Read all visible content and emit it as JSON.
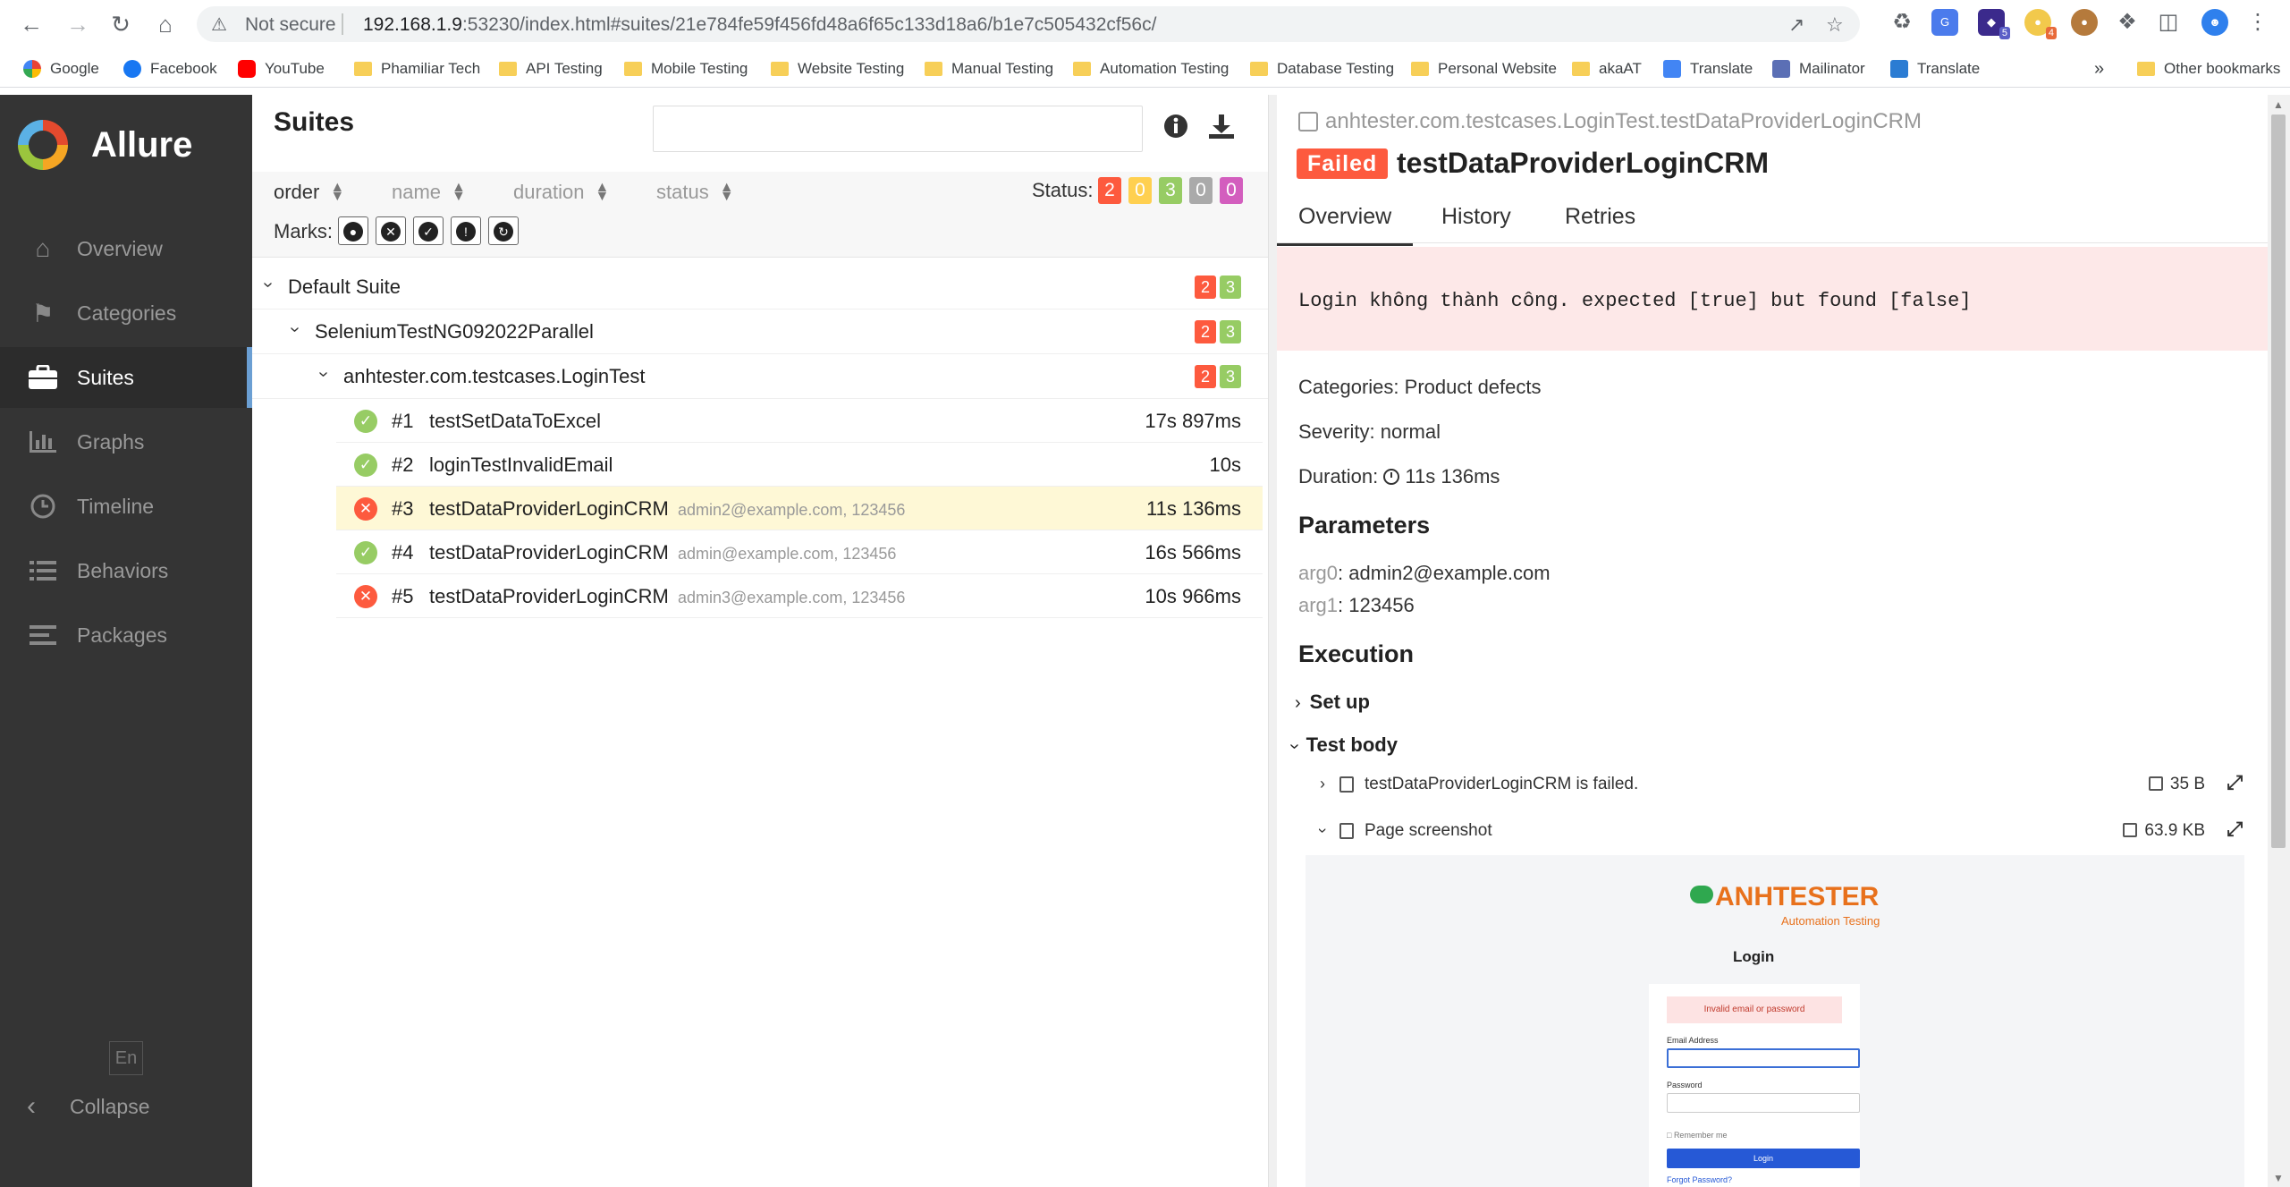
{
  "browser": {
    "not_secure": "Not secure",
    "url_host": "192.168.1.9",
    "url_rest": ":53230/index.html#suites/21e784fe59f456fd48a6f65c133d18a6/b1e7c505432cf56c/",
    "extension_badges": [
      "5",
      "4"
    ],
    "bookmarks": [
      "Google",
      "Facebook",
      "YouTube",
      "Phamiliar Tech",
      "API Testing",
      "Mobile Testing",
      "Website Testing",
      "Manual Testing",
      "Automation Testing",
      "Database Testing",
      "Personal Website",
      "akaAT",
      "Translate",
      "Mailinator",
      "Translate"
    ],
    "more_bookmarks": "»",
    "other_bookmarks": "Other bookmarks"
  },
  "sidebar": {
    "brand": "Allure",
    "items": [
      {
        "label": "Overview",
        "icon": "home-icon"
      },
      {
        "label": "Categories",
        "icon": "flag-icon"
      },
      {
        "label": "Suites",
        "icon": "briefcase-icon"
      },
      {
        "label": "Graphs",
        "icon": "bar-chart-icon"
      },
      {
        "label": "Timeline",
        "icon": "clock-icon"
      },
      {
        "label": "Behaviors",
        "icon": "list-icon"
      },
      {
        "label": "Packages",
        "icon": "align-left-icon"
      }
    ],
    "active": "Suites",
    "language": "En",
    "collapse": "Collapse"
  },
  "suites": {
    "title": "Suites",
    "search_placeholder": "",
    "sort": [
      "order",
      "name",
      "duration",
      "status"
    ],
    "status_label": "Status:",
    "status_counts": [
      {
        "value": "2",
        "color": "#fd5a3e"
      },
      {
        "value": "0",
        "color": "#ffd050"
      },
      {
        "value": "3",
        "color": "#97cc64"
      },
      {
        "value": "0",
        "color": "#aaaaaa"
      },
      {
        "value": "0",
        "color": "#d35ebe"
      }
    ],
    "marks_label": "Marks:",
    "tree": [
      {
        "label": "Default Suite",
        "failed": "2",
        "passed": "3"
      },
      {
        "label": "SeleniumTestNG092022Parallel",
        "failed": "2",
        "passed": "3"
      },
      {
        "label": "anhtester.com.testcases.LoginTest",
        "failed": "2",
        "passed": "3"
      }
    ],
    "tests": [
      {
        "num": "#1",
        "name": "testSetDataToExcel",
        "params": "",
        "duration": "17s 897ms",
        "status": "passed"
      },
      {
        "num": "#2",
        "name": "loginTestInvalidEmail",
        "params": "",
        "duration": "10s",
        "status": "passed"
      },
      {
        "num": "#3",
        "name": "testDataProviderLoginCRM",
        "params": "admin2@example.com, 123456",
        "duration": "11s 136ms",
        "status": "failed"
      },
      {
        "num": "#4",
        "name": "testDataProviderLoginCRM",
        "params": "admin@example.com, 123456",
        "duration": "16s 566ms",
        "status": "passed"
      },
      {
        "num": "#5",
        "name": "testDataProviderLoginCRM",
        "params": "admin3@example.com, 123456",
        "duration": "10s 966ms",
        "status": "failed"
      }
    ]
  },
  "result": {
    "full_name": "anhtester.com.testcases.LoginTest.testDataProviderLoginCRM",
    "status": "Failed",
    "title": "testDataProviderLoginCRM",
    "tabs": [
      "Overview",
      "History",
      "Retries"
    ],
    "error_message": "Login không thành công. expected [true] but found [false]",
    "categories_label": "Categories:",
    "categories_value": "Product defects",
    "severity_label": "Severity:",
    "severity_value": "normal",
    "duration_label": "Duration:",
    "duration_value": "11s 136ms",
    "parameters_heading": "Parameters",
    "params": [
      {
        "key": "arg0",
        "value": "admin2@example.com"
      },
      {
        "key": "arg1",
        "value": "123456"
      }
    ],
    "execution_heading": "Execution",
    "setup_label": "Set up",
    "body_label": "Test body",
    "attachments": [
      {
        "name": "testDataProviderLoginCRM is failed.",
        "size": "35 B"
      },
      {
        "name": "Page screenshot",
        "size": "63.9 KB"
      }
    ]
  },
  "screenshot": {
    "logo": "ANHTESTER",
    "subtitle": "Automation Testing",
    "heading": "Login",
    "alert": "Invalid email or password",
    "email_label": "Email Address",
    "password_label": "Password",
    "remember": "Remember me",
    "login_button": "Login",
    "forgot": "Forgot Password?"
  }
}
